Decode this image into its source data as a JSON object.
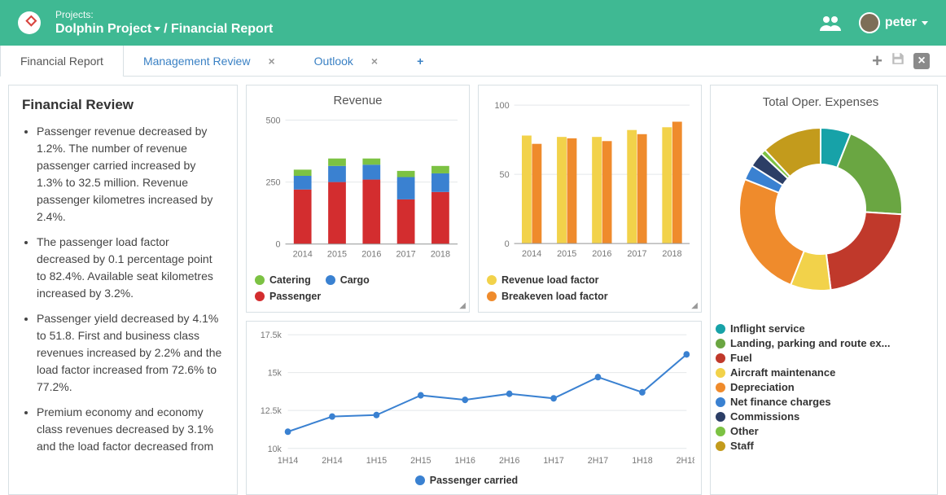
{
  "header": {
    "projects_label": "Projects:",
    "project_name": "Dolphin Project",
    "page": "Financial Report",
    "user": "peter"
  },
  "tabs": {
    "active": "Financial Report",
    "items": [
      {
        "label": "Financial Report",
        "active": true,
        "closable": false
      },
      {
        "label": "Management Review",
        "active": false,
        "closable": true
      },
      {
        "label": "Outlook",
        "active": false,
        "closable": true
      }
    ],
    "add": "+"
  },
  "review": {
    "title": "Financial Review",
    "bullets": [
      "Passenger revenue decreased by 1.2%. The number of revenue passenger carried increased by 1.3% to 32.5 million. Revenue passenger kilometres increased by 2.4%.",
      "The passenger load factor decreased by 0.1 percentage point to 82.4%. Available seat kilometres increased by 3.2%.",
      "Passenger yield decreased by 4.1% to 51.8. First and business class revenues increased by 2.2% and the load factor increased from 72.6% to 77.2%.",
      "Premium economy and economy class revenues decreased by 3.1% and the load factor decreased from"
    ]
  },
  "chart_data": [
    {
      "id": "revenue",
      "type": "bar",
      "stacked": true,
      "title": "Revenue",
      "categories": [
        "2014",
        "2015",
        "2016",
        "2017",
        "2018"
      ],
      "series": [
        {
          "name": "Passenger",
          "color": "#d32d2f",
          "values": [
            220,
            250,
            260,
            180,
            210
          ]
        },
        {
          "name": "Cargo",
          "color": "#3a81d1",
          "values": [
            55,
            65,
            60,
            90,
            75
          ]
        },
        {
          "name": "Catering",
          "color": "#7cc243",
          "values": [
            25,
            30,
            25,
            25,
            30
          ]
        }
      ],
      "ylim": [
        0,
        500
      ]
    },
    {
      "id": "loadfactor",
      "type": "bar",
      "title": "",
      "categories": [
        "2014",
        "2015",
        "2016",
        "2017",
        "2018"
      ],
      "series": [
        {
          "name": "Revenue load factor",
          "color": "#f2d24a",
          "values": [
            78,
            77,
            77,
            82,
            84
          ]
        },
        {
          "name": "Breakeven load factor",
          "color": "#ef8b2c",
          "values": [
            72,
            76,
            74,
            79,
            88
          ]
        }
      ],
      "ylim": [
        0,
        100
      ]
    },
    {
      "id": "pax",
      "type": "line",
      "title": "",
      "x": [
        "1H14",
        "2H14",
        "1H15",
        "2H15",
        "1H16",
        "2H16",
        "1H17",
        "2H17",
        "1H18",
        "2H18"
      ],
      "series": [
        {
          "name": "Passenger carried",
          "color": "#3a81d1",
          "values": [
            11100,
            12100,
            12200,
            13500,
            13200,
            13600,
            13300,
            14700,
            13700,
            16200
          ]
        }
      ],
      "ylim": [
        10000,
        17500
      ]
    },
    {
      "id": "expenses",
      "type": "pie",
      "title": "Total Oper. Expenses",
      "slices": [
        {
          "name": "Inflight service",
          "color": "#17a2a8",
          "value": 6
        },
        {
          "name": "Landing, parking and route ex...",
          "color": "#6aa642",
          "value": 20
        },
        {
          "name": "Fuel",
          "color": "#c0392b",
          "value": 22
        },
        {
          "name": "Aircraft maintenance",
          "color": "#f2d24a",
          "value": 8
        },
        {
          "name": "Depreciation",
          "color": "#ef8b2c",
          "value": 25
        },
        {
          "name": "Net finance charges",
          "color": "#3a81d1",
          "value": 3
        },
        {
          "name": "Commissions",
          "color": "#2c3e66",
          "value": 3
        },
        {
          "name": "Other",
          "color": "#7cc243",
          "value": 1
        },
        {
          "name": "Staff",
          "color": "#c39b1c",
          "value": 12
        }
      ]
    }
  ]
}
